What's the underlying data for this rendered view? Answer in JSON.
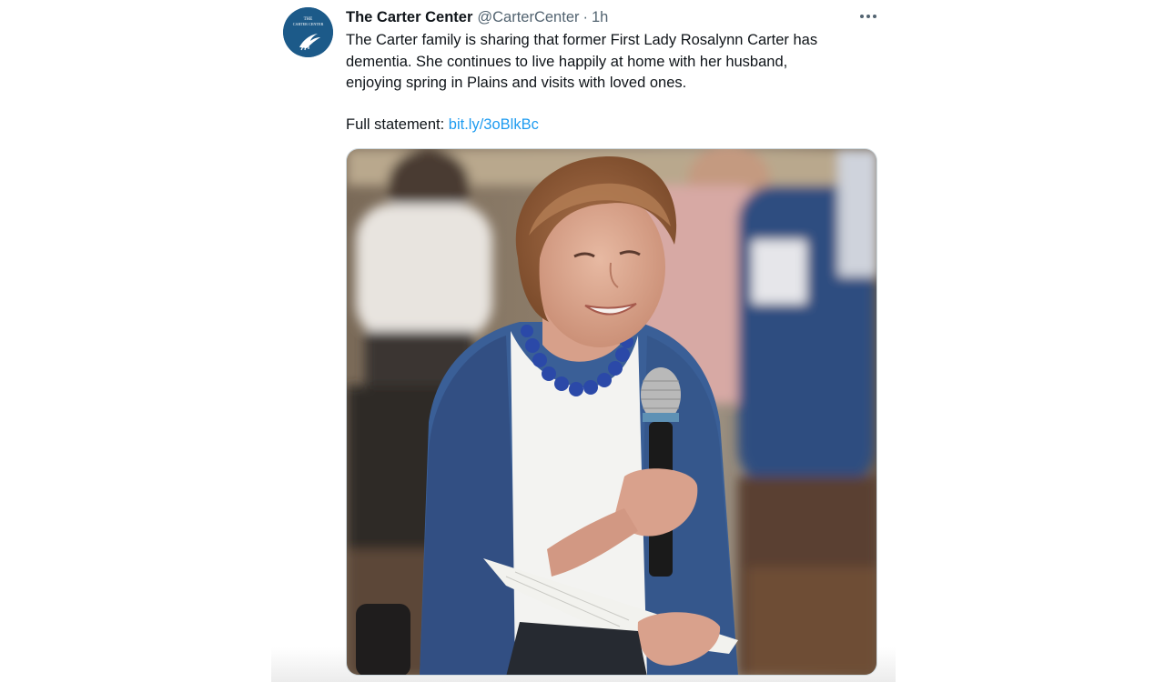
{
  "tweet": {
    "author": {
      "display_name": "The Carter Center",
      "handle": "@CarterCenter",
      "avatar_text_line1": "THE",
      "avatar_text_line2": "CARTER CENTER"
    },
    "separator": "·",
    "timestamp": "1h",
    "text": {
      "line1": "The Carter family is sharing that former First Lady Rosalynn Carter has",
      "line2": "dementia. She continues to live happily at home with her husband,",
      "line3": "enjoying spring in Plains and visits with loved ones."
    },
    "statement_label": "Full statement: ",
    "statement_link": "bit.ly/3oBlkBc",
    "media": {
      "icon": "photo"
    }
  },
  "icons": {
    "more": "more-horizontal-icon"
  },
  "colors": {
    "link": "#1d9bf0",
    "secondary_text": "#536471",
    "primary_text": "#0f1419",
    "avatar_bg": "#1c5a89"
  }
}
